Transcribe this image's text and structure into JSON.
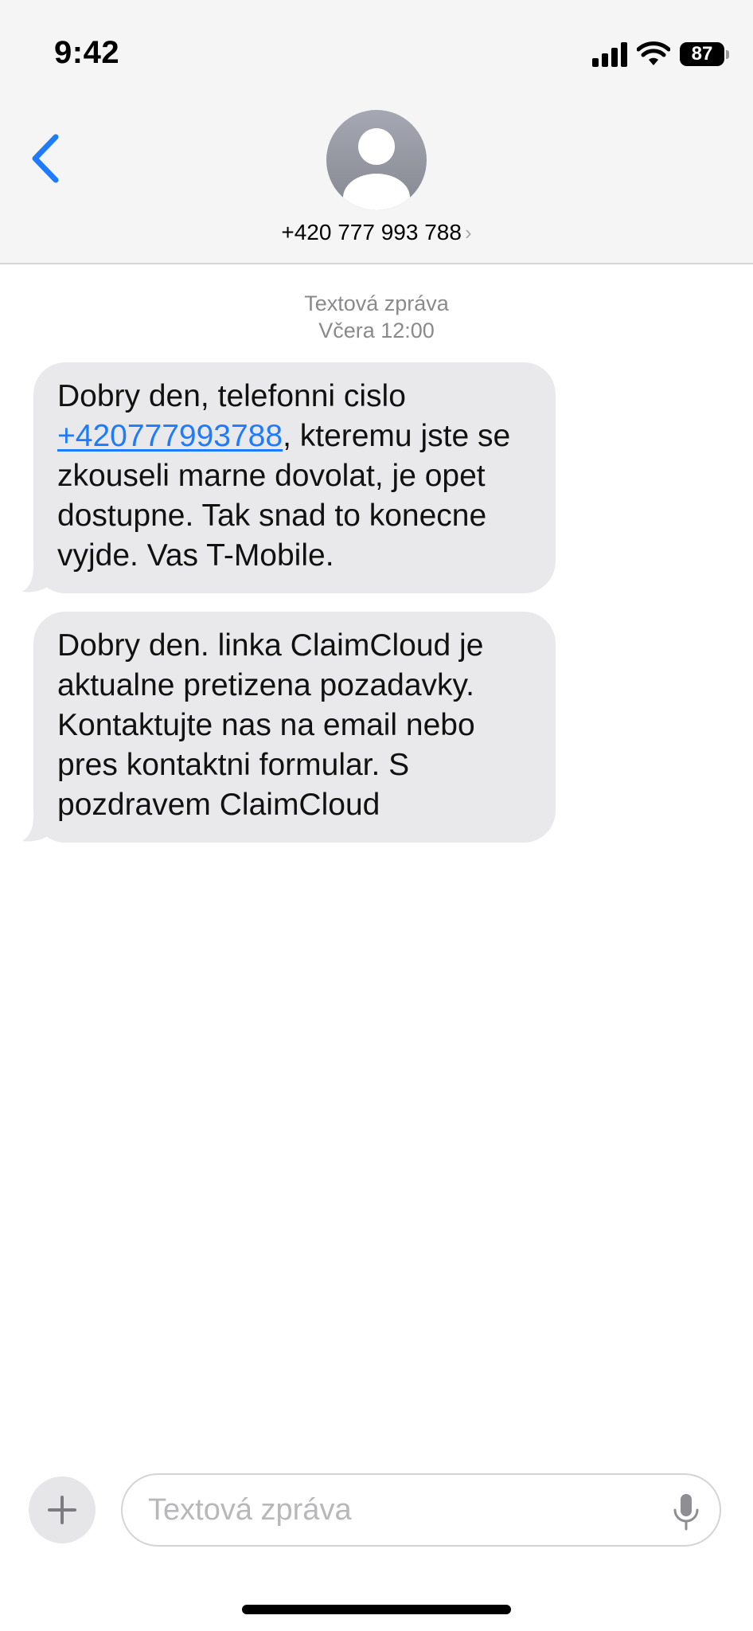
{
  "status_bar": {
    "time": "9:42",
    "battery_level": "87",
    "icons": [
      "signal-icon",
      "wifi-icon",
      "battery-icon"
    ]
  },
  "navigation": {
    "back_icon": "chevron-left-icon",
    "contact_name": "+420 777 993 788",
    "contact_chevron": "›",
    "avatar_icon": "person-icon"
  },
  "thread": {
    "type_label": "Textová zpráva",
    "timestamp": "Včera 12:00"
  },
  "messages": [
    {
      "text_before_link": "Dobry den, telefonni cislo ",
      "link": "+420777993788",
      "text_after_link": ", kteremu jste se zkouseli marne dovolat, je opet dostupne. Tak snad to konecne vyjde. Vas T-Mobile."
    },
    {
      "text": "Dobry den. linka ClaimCloud je aktualne pretizena pozadavky. Kontaktujte nas na email nebo pres kontaktni formular.  S pozdravem ClaimCloud"
    }
  ],
  "composer": {
    "placeholder": "Textová zpráva",
    "value": "",
    "plus_icon": "plus-icon",
    "mic_icon": "microphone-icon"
  },
  "colors": {
    "link": "#1e7bff",
    "bubble_incoming": "#e9e9eb",
    "header_bg": "#f5f5f5",
    "meta_text": "#8a8a8e"
  }
}
